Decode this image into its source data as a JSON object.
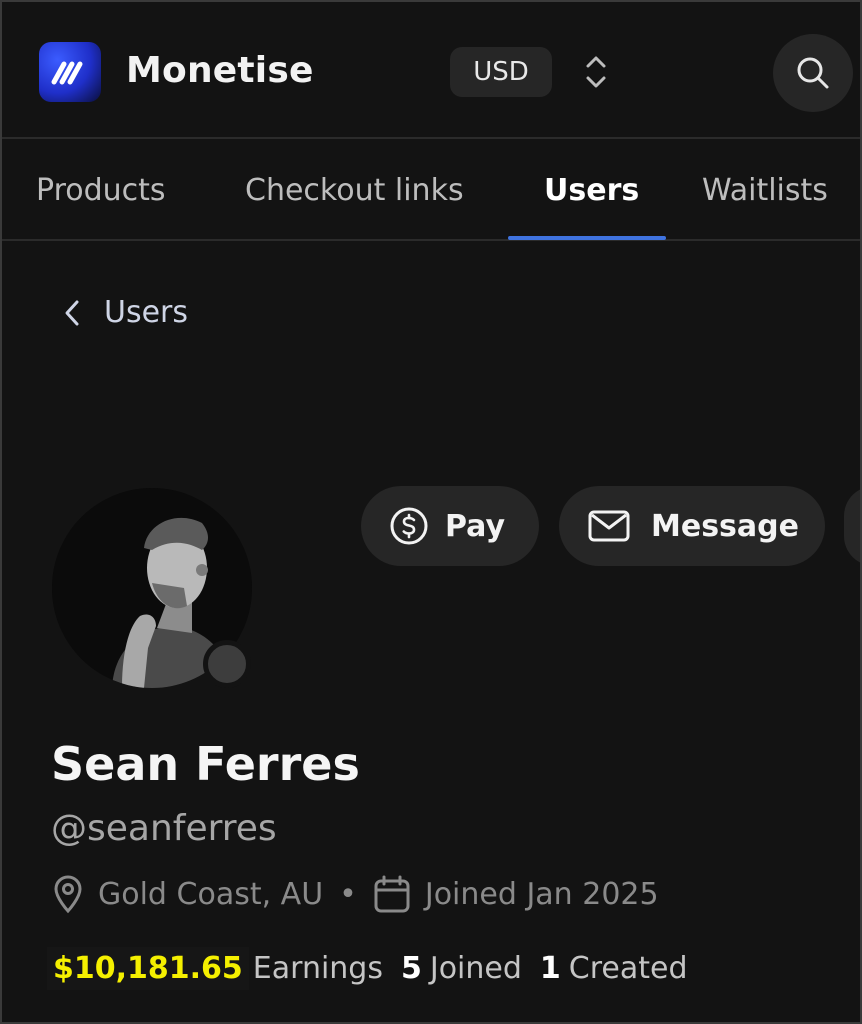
{
  "header": {
    "app_name": "Monetise",
    "currency": "USD",
    "logo_icon": "monetise-logo",
    "brand_color": "#2b3fe6"
  },
  "tabs": [
    {
      "label": "Products",
      "active": false
    },
    {
      "label": "Checkout links",
      "active": false
    },
    {
      "label": "Users",
      "active": true
    },
    {
      "label": "Waitlists",
      "active": false
    }
  ],
  "breadcrumb": {
    "back_label": "Users"
  },
  "actions": {
    "pay_label": "Pay",
    "message_label": "Message"
  },
  "profile": {
    "name": "Sean Ferres",
    "handle": "@seanferres",
    "location": "Gold Coast, AU",
    "separator": "•",
    "joined": "Joined Jan 2025",
    "status_color": "#3d3d3d"
  },
  "stats": {
    "earnings_value": "$10,181.65",
    "earnings_label": "Earnings",
    "joined_count": "5",
    "joined_label": "Joined",
    "created_count": "1",
    "created_label": "Created",
    "earnings_highlight_color": "#f5f000"
  },
  "accent_color": "#3f73e0"
}
